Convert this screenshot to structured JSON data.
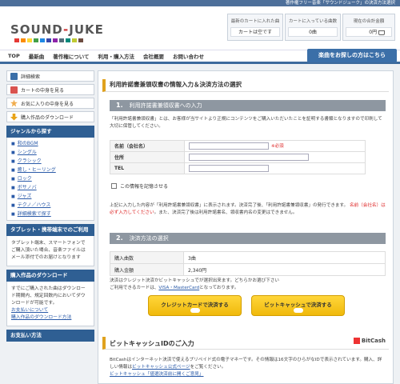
{
  "top_bar": {
    "text": "著作権フリー音楽「サウンドジューク」の決済方法選択"
  },
  "header": {
    "logo": {
      "part1": "SOUND",
      "dash": "-",
      "part2": "JUKE"
    },
    "logo_colors": [
      "#e53935",
      "#fb8c00",
      "#fdd835",
      "#43a047",
      "#1e88e5",
      "#3949ab",
      "#8e24aa",
      "#546e7a",
      "#00897b",
      "#c0ca33",
      "#6d4c41"
    ],
    "cart_recent": {
      "title": "最新のカートに入れた曲",
      "value": "カートは空です"
    },
    "cart_count": {
      "title": "カートに入っている曲数",
      "value": "0曲"
    },
    "cart_total": {
      "title": "現在の合計金額",
      "value": "0円"
    }
  },
  "nav": {
    "items": [
      "TOP",
      "最新曲",
      "著作権について",
      "利用・購入方法",
      "会社概要",
      "お問い合わせ"
    ],
    "search_button": "楽曲をお探しの方はこちら"
  },
  "sidebar": {
    "buttons": [
      {
        "label": "詳細検索",
        "icon": "magnifier-icon",
        "color": "#3b6fa8"
      },
      {
        "label": "カートの中身を見る",
        "icon": "cart-icon",
        "color": "#d9534f"
      },
      {
        "label": "お気に入りの中身を見る",
        "icon": "star-icon",
        "color": "#f0ad4e"
      },
      {
        "label": "購入作品のダウンロード",
        "icon": "download-icon",
        "color": "#e8a317"
      }
    ],
    "genre_heading": "ジャンルから探す",
    "genres": [
      "和のBGM",
      "シングル",
      "クラシック",
      "癒し・ヒーリング",
      "ロック",
      "ボサノバ",
      "ジャズ",
      "テクノ／ハウス",
      "詳細検索で探す"
    ],
    "tablet_heading": "タブレット・携帯端末でのご利用",
    "tablet_text": "タブレット端末、スマートフォンでご購入頂いた場合、音楽ファイルはメール添付でのお届けとなります",
    "download_heading": "購入作品のダウンロード",
    "download_text": "すでにご購入された曲はダウンロード期間内、規定回数内においてダウンロードが可能です。",
    "download_links": [
      "お支払いについて",
      "購入作品のダウンロード方法"
    ],
    "payment_heading": "お支払い方法"
  },
  "main": {
    "page_title": "利用許諾書兼領収書の情報入力＆決済方法の選択",
    "section1": {
      "num": "1.",
      "title": "利用許諾書兼領収書への入力"
    },
    "intro": "「利用許諾書兼領収書」とは、お客様が当サイトより正規にコンテンツをご購入いただいたことを証明する書類となりますので印刷して大切に保管してください。",
    "form": {
      "name_label": "名前（会社名）",
      "required": "※必須",
      "address_label": "住所",
      "tel_label": "TEL",
      "remember": "この情報を記憶させる"
    },
    "notice_line1": "上記に入力した内容が「利用許諾書兼領収書」に表示されます。決済完了後、「利用許諾書兼領収書」の発行できます。",
    "notice_red": "名前（会社名）は必ず入力してください",
    "notice_line2": "。また、決済完了後は利用許諾書名、領収書内名の変更はできません。",
    "section2": {
      "num": "2.",
      "title": "決済方法の選択"
    },
    "purchase": {
      "count_label": "購入曲数",
      "count_value": "3曲",
      "amount_label": "購入金額",
      "amount_value": "2,340円"
    },
    "payment_note1": "決済はクレジット決済かビットキャッシュでが選択出来ます。どちらかお選び下さい",
    "payment_note2_prefix": "ご利用できるカードは、",
    "payment_note2_cards": "VISA・MasterCard",
    "payment_note2_suffix": "となっております。",
    "credit_button": "クレジットカードで決済する",
    "bitcash_button": "ビットキャッシュで決済する",
    "bitcash_heading": "ビットキャッシュIDのご入力",
    "bitcash_logo": "BitCash",
    "bitcash_text": "BitCashはインターネット決済で使えるプリペイド式の電子マネーです。その情報は16文字のひらがなIDで表示されています。購入、詳しい情報は",
    "bitcash_link": "ビットキャッシュ公式ページ",
    "bitcash_text2": "をご覧ください。",
    "bitcash_link2": "ビットキャッシュ「値選決済前に開くご意見」"
  }
}
